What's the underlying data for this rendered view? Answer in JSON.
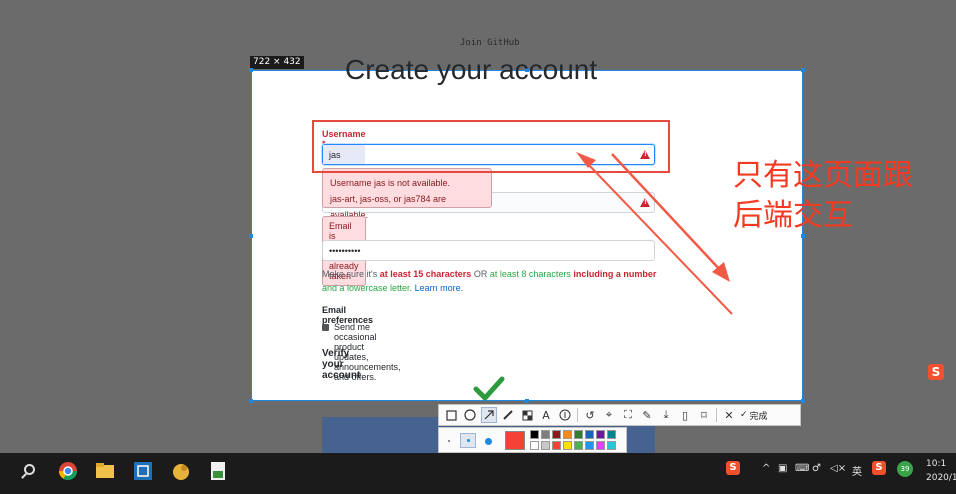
{
  "page": {
    "heading_small": "Join GitHub",
    "headline": "Create your account"
  },
  "capture": {
    "size_label": "722 × 432"
  },
  "form": {
    "username_label": "Username *",
    "username_value": "jas",
    "username_error_line1": "Username jas is not available.",
    "username_error_line2": "jas-art, jas-oss, or jas784 are available.",
    "email_error": "Email is invalid or already taken",
    "password_value": "••••••••••",
    "hint_prefix": "Make sure it's ",
    "hint_req1": "at least 15 characters",
    "hint_or": " OR ",
    "hint_req2": "at least 8 characters",
    "hint_req3": " including a number",
    "hint_req4": "and a lowercase letter.",
    "hint_link": "Learn more.",
    "prefs_title": "Email preferences",
    "prefs_checkbox_label": "Send me occasional product updates, announcements, and offers.",
    "verify_title": "Verify your account"
  },
  "annotation": {
    "line1": "只有这页面跟",
    "line2": "后端交互",
    "color": "#f43a20"
  },
  "toolbar": {
    "tools": [
      "rectangle-icon",
      "ellipse-icon",
      "arrow-icon",
      "pen-icon",
      "mosaic-icon",
      "text-icon",
      "number-icon",
      "undo-icon",
      "pin-icon",
      "scan-icon",
      "translate-icon",
      "download-icon",
      "phone-icon",
      "bookmark-icon",
      "close-icon"
    ],
    "done_label": "完成",
    "active_tool": "arrow-icon"
  },
  "palette": {
    "current_color": "#f44336",
    "colors_row1": [
      "#000000",
      "#7f7f7f",
      "#8b1a1a",
      "#f28a1c",
      "#2e7d32",
      "#1565c0",
      "#6a1b9a",
      "#00838f"
    ],
    "colors_row2": [
      "#ffffff",
      "#c8c8c8",
      "#f44336",
      "#ffe000",
      "#4caf50",
      "#2196f3",
      "#e040fb",
      "#26c6da"
    ]
  },
  "taskbar": {
    "tray_lang": "英",
    "tray_badge": "39",
    "clock_time": "10:1",
    "clock_date": "2020/1"
  }
}
